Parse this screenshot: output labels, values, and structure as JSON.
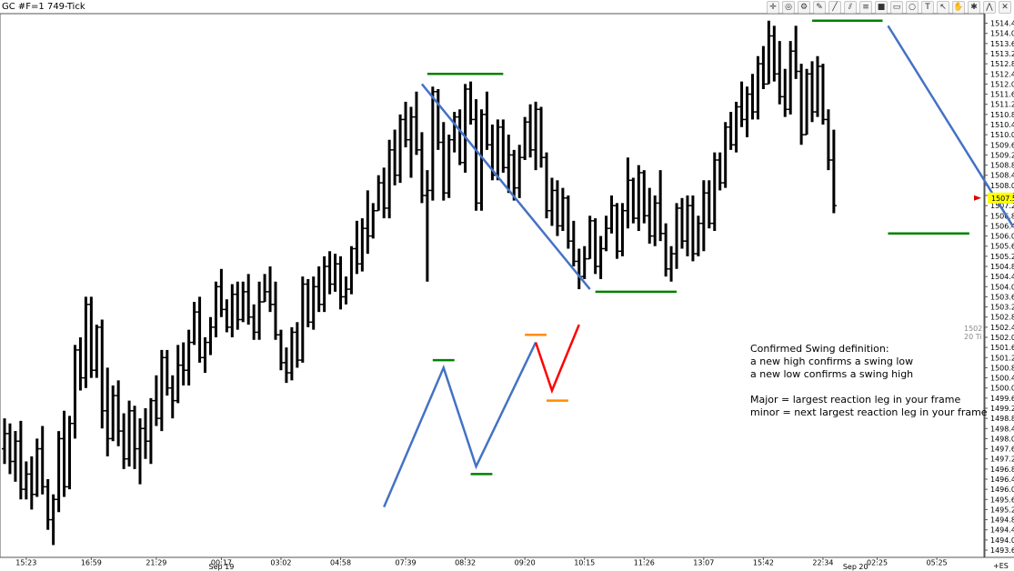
{
  "window": {
    "title": "GC #F=1 749-Tick"
  },
  "toolbar": {
    "icons": [
      "crosshair-icon",
      "target-icon",
      "gear-icon",
      "pencil-icon",
      "line-icon",
      "channel-icon",
      "fibonacci-icon",
      "color-icon",
      "rectangle-icon",
      "ellipse-icon",
      "text-icon",
      "arrow-icon",
      "hand-icon",
      "settings-icon",
      "zigzag-icon",
      "close-icon"
    ],
    "glyphs": [
      "✛",
      "◎",
      "⚙",
      "✎",
      "╱",
      "⫽",
      "≡",
      "■",
      "▭",
      "○",
      "T",
      "↖",
      "✋",
      "✱",
      "⋀",
      "✕"
    ]
  },
  "chart_data": {
    "type": "bar",
    "style": "ohlc",
    "instrument": "GC #F=1 749-Tick",
    "ylim": [
      1493.6,
      1514.6
    ],
    "y_ticks": [
      "1514.4",
      "1514.0",
      "1513.6",
      "1513.2",
      "1512.8",
      "1512.4",
      "1512.0",
      "1511.6",
      "1511.2",
      "1510.8",
      "1510.4",
      "1510.0",
      "1509.6",
      "1509.2",
      "1508.8",
      "1508.4",
      "1508.0",
      "1507.6",
      "1507.2",
      "1506.8",
      "1506.4",
      "1506.0",
      "1505.6",
      "1505.2",
      "1504.8",
      "1504.4",
      "1504.0",
      "1503.6",
      "1503.2",
      "1502.8",
      "1502.4",
      "1502.0",
      "1501.6",
      "1501.2",
      "1500.8",
      "1500.4",
      "1500.0",
      "1499.6",
      "1499.2",
      "1498.8",
      "1498.4",
      "1498.0",
      "1497.6",
      "1497.2",
      "1496.8",
      "1496.4",
      "1496.0",
      "1495.6",
      "1495.2",
      "1494.8",
      "1494.4",
      "1494.0",
      "1493.6"
    ],
    "x_ticks": [
      {
        "label": "15:23",
        "bar": 4
      },
      {
        "label": "16:59",
        "bar": 16
      },
      {
        "label": "21:29",
        "bar": 28
      },
      {
        "label": "00:17",
        "bar": 40
      },
      {
        "label": "03:02",
        "bar": 51
      },
      {
        "label": "04:58",
        "bar": 62
      },
      {
        "label": "07:39",
        "bar": 74
      },
      {
        "label": "08:32",
        "bar": 85
      },
      {
        "label": "09:20",
        "bar": 96
      },
      {
        "label": "10:15",
        "bar": 107
      },
      {
        "label": "11:26",
        "bar": 118
      },
      {
        "label": "13:07",
        "bar": 129
      },
      {
        "label": "15:42",
        "bar": 140
      },
      {
        "label": "22:34",
        "bar": 151
      },
      {
        "label": "02:25",
        "bar": 161
      },
      {
        "label": "05:25",
        "bar": 172
      }
    ],
    "date_labels": [
      {
        "label": "Sep 19",
        "bar": 40
      },
      {
        "label": "Sep 20",
        "bar": 157
      }
    ],
    "last_price": "1507.5",
    "right_edge_labels": [
      "1502",
      "20 Ti"
    ],
    "corner_label": "+ES",
    "bars": [
      [
        1497.6,
        1498.8,
        1497.0,
        1498.2
      ],
      [
        1498.2,
        1498.6,
        1496.6,
        1497.1
      ],
      [
        1497.1,
        1498.3,
        1496.3,
        1497.9
      ],
      [
        1497.9,
        1498.7,
        1495.6,
        1496.0
      ],
      [
        1496.0,
        1497.1,
        1495.6,
        1496.6
      ],
      [
        1496.6,
        1497.3,
        1495.2,
        1495.8
      ],
      [
        1495.8,
        1498.0,
        1495.7,
        1497.6
      ],
      [
        1497.6,
        1498.5,
        1495.8,
        1496.1
      ],
      [
        1496.1,
        1496.4,
        1494.4,
        1494.8
      ],
      [
        1494.8,
        1495.8,
        1493.8,
        1495.6
      ],
      [
        1495.6,
        1498.3,
        1495.1,
        1498.0
      ],
      [
        1498.0,
        1499.1,
        1495.7,
        1496.1
      ],
      [
        1496.1,
        1498.9,
        1496.0,
        1498.6
      ],
      [
        1498.6,
        1501.7,
        1498.0,
        1501.5
      ],
      [
        1501.5,
        1502.0,
        1499.9,
        1500.4
      ],
      [
        1500.4,
        1503.6,
        1500.0,
        1503.3
      ],
      [
        1503.3,
        1503.6,
        1500.4,
        1500.7
      ],
      [
        1500.7,
        1502.5,
        1500.4,
        1502.4
      ],
      [
        1502.4,
        1502.7,
        1498.4,
        1499.1
      ],
      [
        1499.1,
        1500.8,
        1497.3,
        1498.0
      ],
      [
        1498.0,
        1500.1,
        1497.9,
        1499.7
      ],
      [
        1499.7,
        1500.3,
        1497.7,
        1498.3
      ],
      [
        1498.3,
        1499.0,
        1496.8,
        1497.2
      ],
      [
        1497.2,
        1499.5,
        1496.9,
        1499.1
      ],
      [
        1499.1,
        1499.3,
        1496.8,
        1497.6
      ],
      [
        1497.6,
        1498.8,
        1496.2,
        1498.4
      ],
      [
        1498.4,
        1499.2,
        1497.2,
        1497.9
      ],
      [
        1497.9,
        1499.6,
        1497.0,
        1499.5
      ],
      [
        1499.5,
        1500.5,
        1498.5,
        1498.8
      ],
      [
        1498.8,
        1501.5,
        1498.3,
        1501.2
      ],
      [
        1501.2,
        1501.5,
        1499.7,
        1500.0
      ],
      [
        1500.0,
        1500.5,
        1498.8,
        1499.5
      ],
      [
        1499.5,
        1501.7,
        1499.4,
        1500.9
      ],
      [
        1500.9,
        1501.8,
        1500.1,
        1500.7
      ],
      [
        1500.7,
        1502.3,
        1500.1,
        1501.8
      ],
      [
        1501.8,
        1503.4,
        1501.7,
        1503.0
      ],
      [
        1503.0,
        1503.6,
        1501.0,
        1501.2
      ],
      [
        1501.2,
        1502.0,
        1500.6,
        1501.8
      ],
      [
        1501.8,
        1502.8,
        1501.3,
        1502.4
      ],
      [
        1502.4,
        1504.2,
        1502.0,
        1504.0
      ],
      [
        1504.0,
        1504.7,
        1502.8,
        1503.1
      ],
      [
        1503.1,
        1503.5,
        1502.2,
        1502.4
      ],
      [
        1502.4,
        1504.1,
        1502.0,
        1503.7
      ],
      [
        1503.7,
        1504.2,
        1502.3,
        1502.7
      ],
      [
        1502.7,
        1504.2,
        1502.6,
        1503.8
      ],
      [
        1503.8,
        1504.5,
        1502.5,
        1502.8
      ],
      [
        1502.8,
        1503.3,
        1501.9,
        1502.2
      ],
      [
        1502.2,
        1504.2,
        1501.9,
        1503.4
      ],
      [
        1503.4,
        1504.5,
        1503.4,
        1503.8
      ],
      [
        1503.8,
        1504.8,
        1503.0,
        1503.3
      ],
      [
        1503.3,
        1504.2,
        1501.9,
        1502.1
      ],
      [
        1502.1,
        1502.3,
        1500.7,
        1501.0
      ],
      [
        1501.0,
        1501.6,
        1500.2,
        1500.6
      ],
      [
        1500.6,
        1502.4,
        1500.3,
        1502.2
      ],
      [
        1502.2,
        1502.6,
        1500.8,
        1501.1
      ],
      [
        1501.1,
        1504.4,
        1501.0,
        1504.1
      ],
      [
        1504.1,
        1504.3,
        1502.4,
        1502.6
      ],
      [
        1502.6,
        1504.4,
        1502.3,
        1504.0
      ],
      [
        1504.0,
        1504.8,
        1503.0,
        1503.3
      ],
      [
        1503.3,
        1505.2,
        1503.0,
        1504.8
      ],
      [
        1504.8,
        1505.4,
        1503.7,
        1504.1
      ],
      [
        1504.1,
        1505.3,
        1503.8,
        1504.9
      ],
      [
        1504.9,
        1505.2,
        1503.1,
        1503.6
      ],
      [
        1503.6,
        1504.4,
        1503.3,
        1503.9
      ],
      [
        1503.9,
        1505.6,
        1503.7,
        1505.5
      ],
      [
        1505.5,
        1506.6,
        1504.5,
        1504.9
      ],
      [
        1504.9,
        1506.7,
        1504.6,
        1506.3
      ],
      [
        1506.3,
        1507.8,
        1505.3,
        1506.0
      ],
      [
        1506.0,
        1507.3,
        1505.9,
        1507.0
      ],
      [
        1507.0,
        1508.4,
        1507.0,
        1508.1
      ],
      [
        1508.1,
        1508.7,
        1506.7,
        1507.1
      ],
      [
        1507.1,
        1509.8,
        1506.7,
        1509.4
      ],
      [
        1509.4,
        1510.2,
        1508.0,
        1508.4
      ],
      [
        1508.4,
        1510.8,
        1508.1,
        1510.6
      ],
      [
        1510.6,
        1511.3,
        1509.5,
        1509.8
      ],
      [
        1509.8,
        1511.1,
        1508.3,
        1510.7
      ],
      [
        1510.7,
        1511.7,
        1509.2,
        1509.4
      ],
      [
        1509.4,
        1510.1,
        1507.3,
        1507.6
      ],
      [
        1507.6,
        1508.6,
        1504.2,
        1507.8
      ],
      [
        1507.8,
        1511.9,
        1507.4,
        1511.7
      ],
      [
        1511.7,
        1511.8,
        1509.4,
        1509.7
      ],
      [
        1509.7,
        1510.5,
        1507.4,
        1507.7
      ],
      [
        1507.7,
        1510.0,
        1507.5,
        1509.8
      ],
      [
        1509.8,
        1510.9,
        1509.3,
        1510.7
      ],
      [
        1510.7,
        1511.0,
        1508.8,
        1508.9
      ],
      [
        1508.9,
        1512.0,
        1508.5,
        1511.8
      ],
      [
        1511.8,
        1512.1,
        1510.4,
        1510.6
      ],
      [
        1510.6,
        1511.4,
        1507.0,
        1507.3
      ],
      [
        1507.3,
        1511.0,
        1507.0,
        1510.8
      ],
      [
        1510.8,
        1511.7,
        1509.4,
        1509.6
      ],
      [
        1509.6,
        1510.4,
        1508.2,
        1508.4
      ],
      [
        1508.4,
        1510.6,
        1508.2,
        1510.3
      ],
      [
        1510.3,
        1510.6,
        1508.5,
        1508.7
      ],
      [
        1508.7,
        1510.0,
        1507.7,
        1509.2
      ],
      [
        1509.2,
        1509.4,
        1507.4,
        1507.9
      ],
      [
        1507.9,
        1509.6,
        1507.5,
        1509.1
      ],
      [
        1509.1,
        1510.7,
        1509.0,
        1510.5
      ],
      [
        1510.5,
        1511.2,
        1509.1,
        1509.4
      ],
      [
        1509.4,
        1511.3,
        1508.6,
        1511.0
      ],
      [
        1511.0,
        1511.1,
        1508.7,
        1509.1
      ],
      [
        1509.1,
        1509.3,
        1506.7,
        1507.0
      ],
      [
        1507.0,
        1508.3,
        1506.4,
        1507.8
      ],
      [
        1507.8,
        1508.2,
        1506.0,
        1506.4
      ],
      [
        1506.4,
        1507.9,
        1506.2,
        1507.5
      ],
      [
        1507.5,
        1507.6,
        1505.5,
        1505.8
      ],
      [
        1505.8,
        1506.6,
        1504.8,
        1505.0
      ],
      [
        1505.0,
        1505.5,
        1503.9,
        1504.4
      ],
      [
        1504.4,
        1505.6,
        1504.3,
        1505.1
      ],
      [
        1505.1,
        1506.8,
        1505.1,
        1506.6
      ],
      [
        1506.6,
        1506.7,
        1504.5,
        1504.8
      ],
      [
        1504.8,
        1506.0,
        1504.3,
        1505.5
      ],
      [
        1505.5,
        1506.8,
        1505.4,
        1506.3
      ],
      [
        1506.3,
        1507.6,
        1506.1,
        1507.2
      ],
      [
        1507.2,
        1507.3,
        1505.1,
        1505.4
      ],
      [
        1505.4,
        1507.3,
        1505.2,
        1507.0
      ],
      [
        1507.0,
        1509.1,
        1506.3,
        1508.2
      ],
      [
        1508.2,
        1508.3,
        1506.5,
        1506.7
      ],
      [
        1506.7,
        1508.8,
        1506.2,
        1508.5
      ],
      [
        1508.5,
        1508.6,
        1506.5,
        1506.8
      ],
      [
        1506.8,
        1507.9,
        1505.7,
        1506.0
      ],
      [
        1506.0,
        1507.6,
        1505.6,
        1507.3
      ],
      [
        1507.3,
        1508.6,
        1505.8,
        1506.1
      ],
      [
        1506.1,
        1506.5,
        1504.4,
        1504.7
      ],
      [
        1504.7,
        1505.6,
        1504.2,
        1505.3
      ],
      [
        1505.3,
        1507.3,
        1504.7,
        1507.1
      ],
      [
        1507.1,
        1507.5,
        1505.5,
        1505.8
      ],
      [
        1505.8,
        1507.6,
        1505.2,
        1507.2
      ],
      [
        1507.2,
        1507.6,
        1505.0,
        1505.3
      ],
      [
        1505.3,
        1506.8,
        1505.2,
        1506.5
      ],
      [
        1506.5,
        1508.2,
        1505.4,
        1507.7
      ],
      [
        1507.7,
        1508.2,
        1506.3,
        1506.5
      ],
      [
        1506.5,
        1509.3,
        1506.2,
        1509.0
      ],
      [
        1509.0,
        1509.3,
        1507.8,
        1508.1
      ],
      [
        1508.1,
        1510.5,
        1507.9,
        1510.3
      ],
      [
        1510.3,
        1510.9,
        1509.4,
        1509.6
      ],
      [
        1509.6,
        1511.3,
        1509.3,
        1511.1
      ],
      [
        1511.1,
        1512.1,
        1510.3,
        1510.6
      ],
      [
        1510.6,
        1511.9,
        1509.9,
        1511.6
      ],
      [
        1511.6,
        1512.4,
        1510.6,
        1510.9
      ],
      [
        1510.9,
        1513.1,
        1510.6,
        1512.8
      ],
      [
        1512.8,
        1513.5,
        1511.8,
        1512.0
      ],
      [
        1512.0,
        1514.5,
        1512.0,
        1513.9
      ],
      [
        1513.9,
        1514.3,
        1512.1,
        1512.4
      ],
      [
        1512.4,
        1513.7,
        1511.2,
        1511.5
      ],
      [
        1511.5,
        1512.6,
        1510.7,
        1511.0
      ],
      [
        1511.0,
        1513.7,
        1510.8,
        1513.3
      ],
      [
        1513.3,
        1514.3,
        1512.2,
        1512.5
      ],
      [
        1512.5,
        1512.8,
        1509.6,
        1510.0
      ],
      [
        1510.0,
        1512.6,
        1510.0,
        1512.4
      ],
      [
        1512.4,
        1512.9,
        1510.5,
        1510.9
      ],
      [
        1510.9,
        1513.1,
        1510.7,
        1512.7
      ],
      [
        1512.7,
        1512.8,
        1510.4,
        1510.6
      ],
      [
        1510.6,
        1511.0,
        1508.6,
        1509.0
      ],
      [
        1509.0,
        1510.2,
        1506.9,
        1507.2
      ]
    ],
    "annotations": {
      "swing_lines": [
        {
          "color": "#4472c4",
          "from": [
            77,
            1512.0
          ],
          "to": [
            108,
            1503.9
          ]
        },
        {
          "color": "#4472c4",
          "from": [
            163,
            1514.3
          ],
          "to": [
            186,
            1506.4
          ]
        }
      ],
      "level_lines": [
        {
          "color": "#008000",
          "bars": [
            78,
            92
          ],
          "y": 1512.4
        },
        {
          "color": "#008000",
          "bars": [
            109,
            124
          ],
          "y": 1503.8
        },
        {
          "color": "#008000",
          "bars": [
            149,
            162
          ],
          "y": 1514.5
        },
        {
          "color": "#008000",
          "bars": [
            163,
            178
          ],
          "y": 1506.1
        }
      ],
      "zigzag_blue": [
        [
          70,
          1495.3
        ],
        [
          81,
          1500.8
        ],
        [
          87,
          1496.9
        ],
        [
          98,
          1501.8
        ]
      ],
      "zigzag_red": [
        [
          98,
          1501.8
        ],
        [
          101,
          1499.9
        ],
        [
          106,
          1502.5
        ]
      ],
      "zigzag_ticks": [
        {
          "color": "#008000",
          "bars": [
            79,
            83
          ],
          "y": 1501.1
        },
        {
          "color": "#008000",
          "bars": [
            86,
            90
          ],
          "y": 1496.6
        },
        {
          "color": "#ff8c00",
          "bars": [
            96,
            100
          ],
          "y": 1502.1
        },
        {
          "color": "#ff8c00",
          "bars": [
            100,
            104
          ],
          "y": 1499.5
        }
      ]
    }
  },
  "definitions": {
    "lines": [
      "Confirmed Swing definition:",
      "a new high confirms a swing low",
      "a new low confirms a swing high",
      "",
      "Major = largest reaction leg in your frame",
      "minor = next largest reaction leg in your frame"
    ]
  }
}
